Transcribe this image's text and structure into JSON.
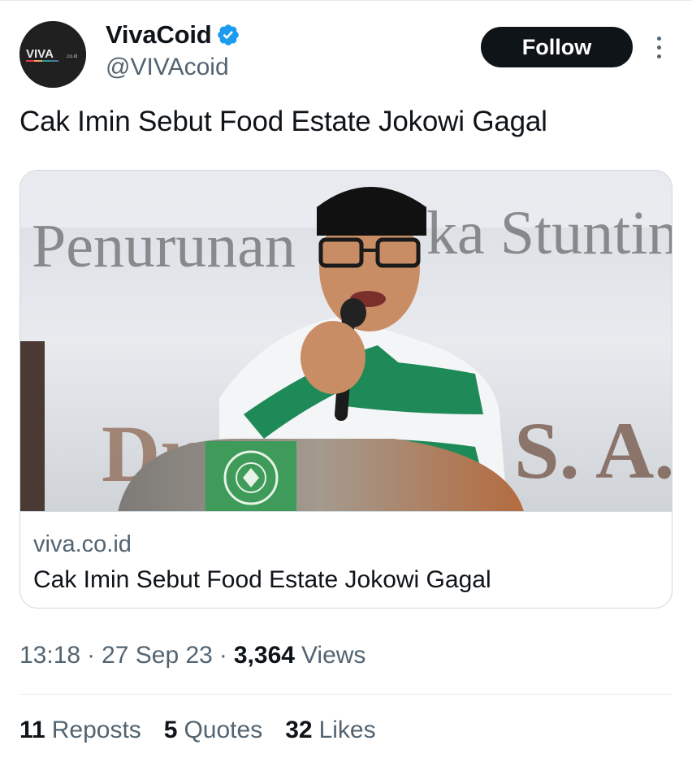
{
  "account": {
    "display_name": "VivaCoid",
    "handle": "@VIVAcoid",
    "verified": true,
    "avatar_text": "VIVA",
    "avatar_subtext": ".co.id"
  },
  "actions": {
    "follow_label": "Follow"
  },
  "tweet": {
    "text": "Cak Imin Sebut Food Estate Jokowi Gagal"
  },
  "card": {
    "image_banner_text_top_left": "Penurunan",
    "image_banner_text_top_right": "ka Stuntin",
    "image_banner_text_bottom_left": "Dr",
    "image_banner_text_bottom_right": "S. A.",
    "domain": "viva.co.id",
    "title": "Cak Imin Sebut Food Estate Jokowi Gagal"
  },
  "meta": {
    "time": "13:18",
    "separator": "·",
    "date": "27 Sep 23",
    "views_count": "3,364",
    "views_label": "Views"
  },
  "stats": [
    {
      "count": "11",
      "label": "Reposts"
    },
    {
      "count": "5",
      "label": "Quotes"
    },
    {
      "count": "32",
      "label": "Likes"
    }
  ],
  "colors": {
    "text_primary": "#0f1419",
    "text_secondary": "#536471",
    "verified_blue": "#1d9bf0",
    "border": "#cfd9de",
    "jacket_green": "#1e8a57"
  },
  "icons": {
    "verified": "verified-badge-icon",
    "more": "more-options-icon"
  }
}
